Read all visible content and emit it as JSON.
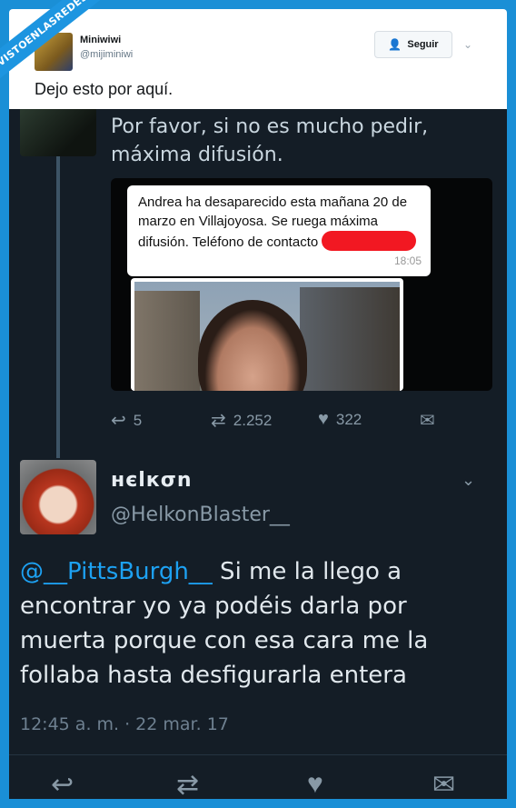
{
  "watermark": "VISTOENLASREDES",
  "outer_tweet": {
    "name": "Miniwiwi",
    "handle": "@mijiminiwi",
    "follow_label": "Seguir",
    "text": "Dejo esto por aquí."
  },
  "prev_tweet": {
    "text": "Por favor, si no es mucho pedir, máxima difusión.",
    "message": "Andrea ha desaparecido esta mañana 20 de marzo en Villajoyosa. Se ruega máxima difusión. Teléfono de contacto",
    "message_time": "18:05",
    "replies": "5",
    "retweets": "2.252",
    "likes": "322"
  },
  "reply_tweet": {
    "name": "нєlкσn",
    "handle": "@HelkonBlaster__",
    "mention": "@__PittsBurgh__",
    "text": " Si me la llego a encontrar yo ya podéis darla por muerta porque con esa cara me la follaba hasta desfigurarla entera",
    "timestamp": "12:45 a. m. · 22 mar. 17"
  },
  "icons": {
    "reply": "reply-icon",
    "retweet": "retweet-icon",
    "like": "heart-icon",
    "dm": "envelope-icon"
  },
  "colors": {
    "accent": "#1da1f2",
    "dark_bg": "#141d26",
    "watermark_bg": "#1a8fd6"
  }
}
